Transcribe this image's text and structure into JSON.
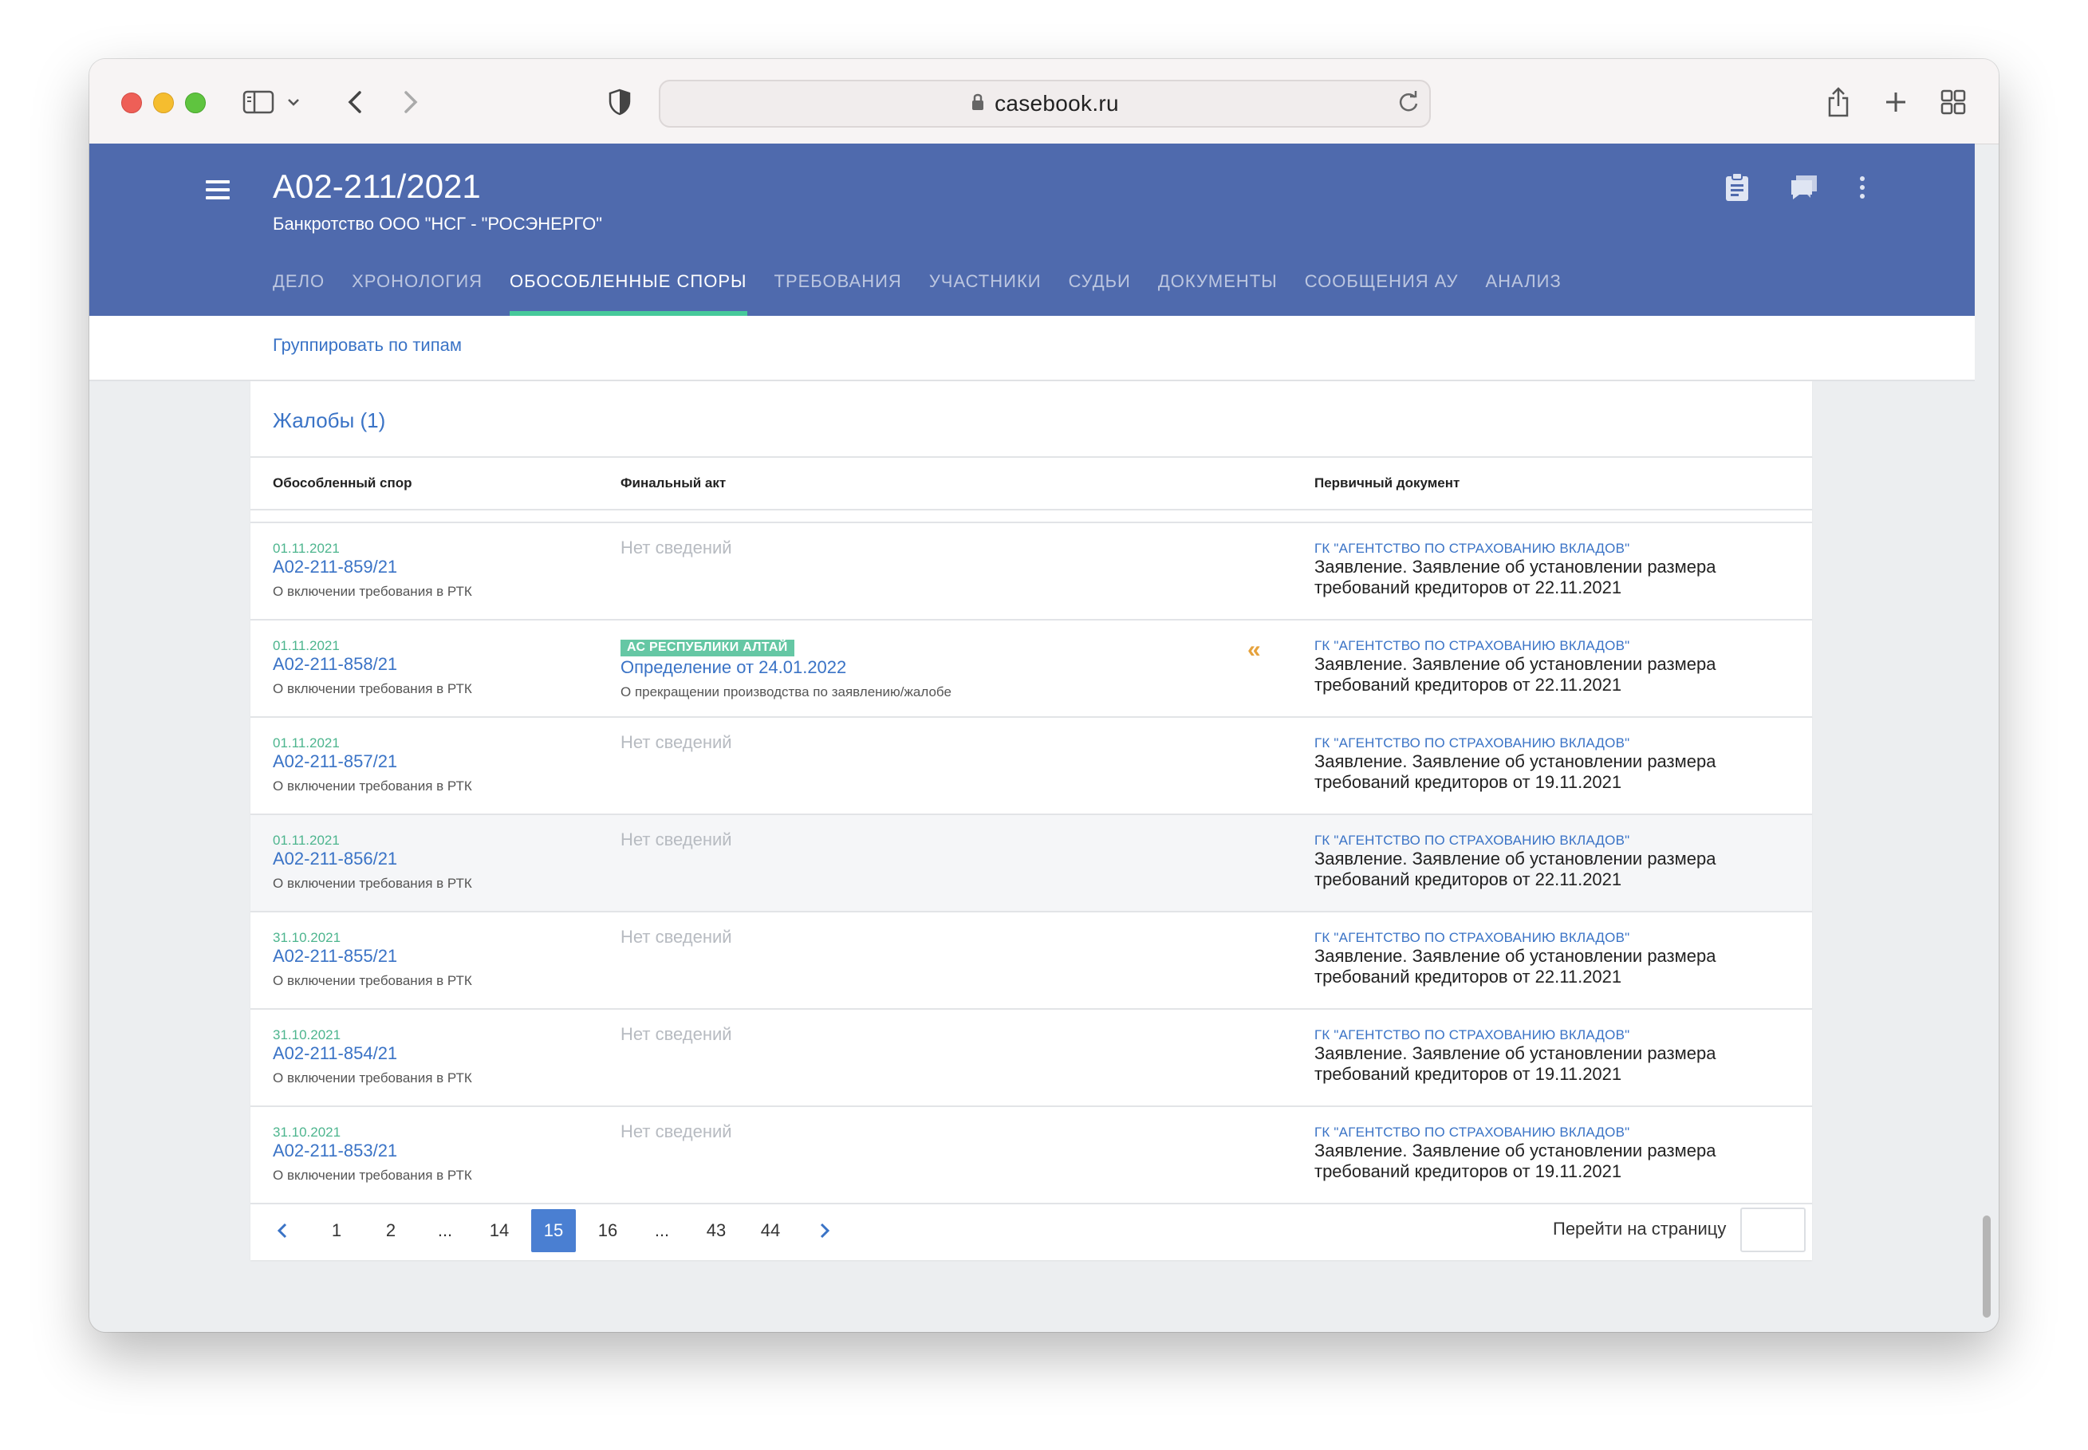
{
  "browser": {
    "url": "casebook.ru"
  },
  "header": {
    "case_number": "А02-211/2021",
    "case_subtitle": "Банкротство ООО \"НСГ - \"РОСЭНЕРГО\"",
    "tabs": [
      {
        "label": "ДЕЛО",
        "active": false
      },
      {
        "label": "ХРОНОЛОГИЯ",
        "active": false
      },
      {
        "label": "ОБОСОБЛЕННЫЕ СПОРЫ",
        "active": true
      },
      {
        "label": "ТРЕБОВАНИЯ",
        "active": false
      },
      {
        "label": "УЧАСТНИКИ",
        "active": false
      },
      {
        "label": "СУДЬИ",
        "active": false
      },
      {
        "label": "ДОКУМЕНТЫ",
        "active": false
      },
      {
        "label": "СООБЩЕНИЯ АУ",
        "active": false
      },
      {
        "label": "АНАЛИЗ",
        "active": false
      }
    ]
  },
  "subbar": {
    "group_link": "Группировать по типам"
  },
  "section": {
    "title": "Жалобы (1)",
    "columns": [
      "Обособленный спор",
      "Финальный акт",
      "Первичный документ"
    ],
    "rows": [
      {
        "date": "01.11.2021",
        "number": "А02-211-859/21",
        "desc": "О включении требования в РТК",
        "final_none": "Нет сведений",
        "org": "ГК \"АГЕНТСТВО ПО СТРАХОВАНИЮ ВКЛАДОВ\"",
        "doc": "Заявление. Заявление об установлении размера требований кредиторов от 22.11.2021"
      },
      {
        "date": "01.11.2021",
        "number": "А02-211-858/21",
        "desc": "О включении требования в РТК",
        "court": "АС РЕСПУБЛИКИ АЛТАЙ",
        "act": "Определение от 24.01.2022",
        "act_desc": "О прекращении производства по заявлению/жалобе",
        "arrow": "«",
        "org": "ГК \"АГЕНТСТВО ПО СТРАХОВАНИЮ ВКЛАДОВ\"",
        "doc": "Заявление. Заявление об установлении размера требований кредиторов от 22.11.2021"
      },
      {
        "date": "01.11.2021",
        "number": "А02-211-857/21",
        "desc": "О включении требования в РТК",
        "final_none": "Нет сведений",
        "org": "ГК \"АГЕНТСТВО ПО СТРАХОВАНИЮ ВКЛАДОВ\"",
        "doc": "Заявление. Заявление об установлении размера требований кредиторов от 19.11.2021"
      },
      {
        "date": "01.11.2021",
        "number": "А02-211-856/21",
        "desc": "О включении требования в РТК",
        "final_none": "Нет сведений",
        "org": "ГК \"АГЕНТСТВО ПО СТРАХОВАНИЮ ВКЛАДОВ\"",
        "doc": "Заявление. Заявление об установлении размера требований кредиторов от 22.11.2021"
      },
      {
        "date": "31.10.2021",
        "number": "А02-211-855/21",
        "desc": "О включении требования в РТК",
        "final_none": "Нет сведений",
        "org": "ГК \"АГЕНТСТВО ПО СТРАХОВАНИЮ ВКЛАДОВ\"",
        "doc": "Заявление. Заявление об установлении размера требований кредиторов от 22.11.2021"
      },
      {
        "date": "31.10.2021",
        "number": "А02-211-854/21",
        "desc": "О включении требования в РТК",
        "final_none": "Нет сведений",
        "org": "ГК \"АГЕНТСТВО ПО СТРАХОВАНИЮ ВКЛАДОВ\"",
        "doc": "Заявление. Заявление об установлении размера требований кредиторов от 19.11.2021"
      },
      {
        "date": "31.10.2021",
        "number": "А02-211-853/21",
        "desc": "О включении требования в РТК",
        "final_none": "Нет сведений",
        "org": "ГК \"АГЕНТСТВО ПО СТРАХОВАНИЮ ВКЛАДОВ\"",
        "doc": "Заявление. Заявление об установлении размера требований кредиторов от 19.11.2021"
      }
    ]
  },
  "pagination": {
    "pages": [
      "1",
      "2",
      "...",
      "14",
      "15",
      "16",
      "...",
      "43",
      "44"
    ],
    "current": "15",
    "goto_label": "Перейти на страницу",
    "goto_value": ""
  },
  "colors": {
    "appbar": "#4f6aad",
    "active_tab_underline": "#46c99a",
    "link": "#3a73c6",
    "date": "#4db58e",
    "court_badge": "#65c7a4",
    "arrow": "#e6a23c",
    "pager_active": "#4a7fd2"
  }
}
